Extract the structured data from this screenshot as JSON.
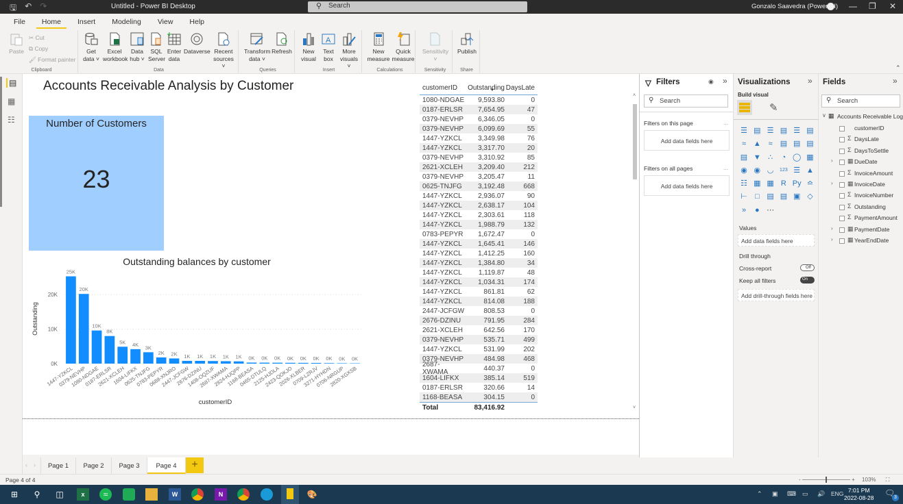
{
  "window": {
    "title": "Untitled - Power BI Desktop",
    "search_placeholder": "Search",
    "user": "Gonzalo Saavedra (Power BI)"
  },
  "menu": [
    "File",
    "Home",
    "Insert",
    "Modeling",
    "View",
    "Help"
  ],
  "menu_active": "Home",
  "ribbon": {
    "clipboard": {
      "label": "Clipboard",
      "paste": "Paste",
      "cut": "Cut",
      "copy": "Copy",
      "format_painter": "Format painter"
    },
    "data": {
      "label": "Data",
      "get_data": "Get data",
      "excel": "Excel workbook",
      "data_hub": "Data hub",
      "sql": "SQL Server",
      "enter_data": "Enter data",
      "dataverse": "Dataverse",
      "recent": "Recent sources"
    },
    "queries": {
      "label": "Queries",
      "transform": "Transform data",
      "refresh": "Refresh"
    },
    "insert": {
      "label": "Insert",
      "new_visual": "New visual",
      "text_box": "Text box",
      "more_visuals": "More visuals"
    },
    "calculations": {
      "label": "Calculations",
      "new_measure": "New measure",
      "quick_measure": "Quick measure"
    },
    "sensitivity": {
      "label": "Sensitivity",
      "sensitivity": "Sensitivity"
    },
    "share": {
      "label": "Share",
      "publish": "Publish"
    }
  },
  "report": {
    "title": "Accounts Receivable Analysis by Customer",
    "card": {
      "title": "Number of Customers",
      "value": "23",
      "color": "#a0cfff"
    }
  },
  "chart_data": {
    "type": "bar",
    "title": "Outstanding balances by customer",
    "xlabel": "customerID",
    "ylabel": "Outstanding",
    "ylim": [
      0,
      26000
    ],
    "yticks": [
      0,
      10000,
      20000
    ],
    "ytick_labels": [
      "0K",
      "10K",
      "20K"
    ],
    "grid": true,
    "bar_color": "#118dff",
    "categories": [
      "1447-YZKCL",
      "0379-NEVHP",
      "1080-NDGAE",
      "0187-ERLSR",
      "2621-XCLEH",
      "1604-LIFKX",
      "0625-TNJFG",
      "0783-PEPYR",
      "0688-XNJRO",
      "2447-JCFGW",
      "2676-DZINU",
      "1408-OQZUF",
      "2687-XWAMA",
      "2824-HJQPP",
      "1168-BEASA",
      "0465-DTULQ",
      "2125-HJDLA",
      "2423-QOKJO",
      "2026-XLBER",
      "0709-LZRJV",
      "3271-HYHDN",
      "0706-NRGUP",
      "2820-XGXSB"
    ],
    "values": [
      25300,
      20200,
      9600,
      8000,
      4900,
      4200,
      3300,
      1800,
      1500,
      800,
      800,
      750,
      700,
      650,
      300,
      280,
      260,
      240,
      220,
      200,
      150,
      120,
      100
    ],
    "data_labels": [
      "25K",
      "20K",
      "10K",
      "8K",
      "5K",
      "4K",
      "3K",
      "2K",
      "2K",
      "1K",
      "1K",
      "1K",
      "1K",
      "1K",
      "0K",
      "0K",
      "0K",
      "0K",
      "0K",
      "0K",
      "0K",
      "0K",
      "0K"
    ]
  },
  "table": {
    "columns": [
      "customerID",
      "Outstanding",
      "DaysLate"
    ],
    "rows": [
      [
        "1080-NDGAE",
        "9,593.80",
        "0"
      ],
      [
        "0187-ERLSR",
        "7,654.95",
        "47"
      ],
      [
        "0379-NEVHP",
        "6,346.05",
        "0"
      ],
      [
        "0379-NEVHP",
        "6,099.69",
        "55"
      ],
      [
        "1447-YZKCL",
        "3,349.98",
        "76"
      ],
      [
        "1447-YZKCL",
        "3,317.70",
        "20"
      ],
      [
        "0379-NEVHP",
        "3,310.92",
        "85"
      ],
      [
        "2621-XCLEH",
        "3,209.40",
        "212"
      ],
      [
        "0379-NEVHP",
        "3,205.47",
        "11"
      ],
      [
        "0625-TNJFG",
        "3,192.48",
        "668"
      ],
      [
        "1447-YZKCL",
        "2,936.07",
        "90"
      ],
      [
        "1447-YZKCL",
        "2,638.17",
        "104"
      ],
      [
        "1447-YZKCL",
        "2,303.61",
        "118"
      ],
      [
        "1447-YZKCL",
        "1,988.79",
        "132"
      ],
      [
        "0783-PEPYR",
        "1,672.47",
        "0"
      ],
      [
        "1447-YZKCL",
        "1,645.41",
        "146"
      ],
      [
        "1447-YZKCL",
        "1,412.25",
        "160"
      ],
      [
        "1447-YZKCL",
        "1,384.80",
        "34"
      ],
      [
        "1447-YZKCL",
        "1,119.87",
        "48"
      ],
      [
        "1447-YZKCL",
        "1,034.31",
        "174"
      ],
      [
        "1447-YZKCL",
        "861.81",
        "62"
      ],
      [
        "1447-YZKCL",
        "814.08",
        "188"
      ],
      [
        "2447-JCFGW",
        "808.53",
        "0"
      ],
      [
        "2676-DZINU",
        "791.95",
        "284"
      ],
      [
        "2621-XCLEH",
        "642.56",
        "170"
      ],
      [
        "0379-NEVHP",
        "535.71",
        "499"
      ],
      [
        "1447-YZKCL",
        "531.99",
        "202"
      ],
      [
        "0379-NEVHP",
        "484.98",
        "468"
      ],
      [
        "2687-XWAMA",
        "440.37",
        "0"
      ],
      [
        "1604-LIFKX",
        "385.14",
        "519"
      ],
      [
        "0187-ERLSR",
        "320.66",
        "14"
      ],
      [
        "1168-BEASA",
        "304.15",
        "0"
      ]
    ],
    "total_label": "Total",
    "total_value": "83,416.92"
  },
  "filters": {
    "title": "Filters",
    "search": "Search",
    "on_this_page": "Filters on this page",
    "on_all_pages": "Filters on all pages",
    "add_fields": "Add data fields here",
    "more": "..."
  },
  "visualizations": {
    "title": "Visualizations",
    "build_visual": "Build visual",
    "values_label": "Values",
    "values_add": "Add data fields here",
    "drill_through": "Drill through",
    "cross_report": "Cross-report",
    "cross_report_state": "Off",
    "keep_all_filters": "Keep all filters",
    "keep_all_filters_state": "On",
    "drill_add": "Add drill-through fields here"
  },
  "fields": {
    "title": "Fields",
    "search": "Search",
    "table_name": "Accounts Receivable Log",
    "items": [
      {
        "name": "customerID",
        "type": "text",
        "expandable": false
      },
      {
        "name": "DaysLate",
        "type": "sum",
        "expandable": false
      },
      {
        "name": "DaysToSettle",
        "type": "sum",
        "expandable": false
      },
      {
        "name": "DueDate",
        "type": "date",
        "expandable": true
      },
      {
        "name": "InvoiceAmount",
        "type": "sum",
        "expandable": false
      },
      {
        "name": "InvoiceDate",
        "type": "date",
        "expandable": true
      },
      {
        "name": "InvoiceNumber",
        "type": "sum",
        "expandable": false
      },
      {
        "name": "Outstanding",
        "type": "sum",
        "expandable": false
      },
      {
        "name": "PaymentAmount",
        "type": "sum",
        "expandable": false
      },
      {
        "name": "PaymentDate",
        "type": "date",
        "expandable": true
      },
      {
        "name": "YearEndDate",
        "type": "date",
        "expandable": true
      }
    ]
  },
  "pages": [
    "Page 1",
    "Page 2",
    "Page 3",
    "Page 4"
  ],
  "active_page": "Page 4",
  "status": {
    "page_info": "Page 4 of 4",
    "zoom": "103%"
  },
  "taskbar": {
    "apps": [
      "windows-start",
      "search",
      "task-view",
      "excel",
      "spotify",
      "google-chat",
      "file-explorer",
      "word",
      "chrome",
      "onenote",
      "chrome-profile",
      "edge",
      "power-bi",
      "paint"
    ],
    "language": "ENG",
    "time": "7:01 PM",
    "date": "2022-08-28",
    "notifications": "3"
  }
}
